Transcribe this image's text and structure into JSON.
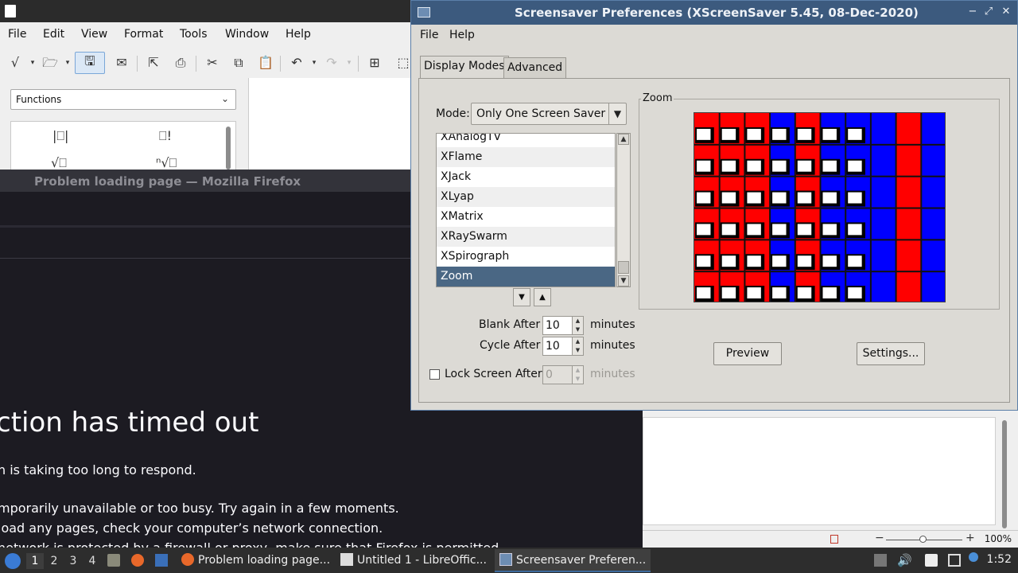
{
  "libreoffice": {
    "menus": [
      "File",
      "Edit",
      "View",
      "Format",
      "Tools",
      "Window",
      "Help"
    ],
    "elements_select": "Functions",
    "zoom": "100%",
    "zoom_minus": "−",
    "zoom_plus": "+"
  },
  "firefox": {
    "window_title": "Problem loading page — Mozilla Firefox",
    "heading": "ction has timed out",
    "subtext": "n is taking too long to respond.",
    "bullets": [
      "mporarily unavailable or too busy. Try again in a few moments.",
      "load any pages, check your computer’s network connection.",
      "network is protected by a firewall or proxy, make sure that Firefox is permitted"
    ]
  },
  "xscreensaver": {
    "title": "Screensaver Preferences  (XScreenSaver 5.45, 08-Dec-2020)",
    "menus": [
      "File",
      "Help"
    ],
    "tabs": [
      "Display Modes",
      "Advanced"
    ],
    "mode_label": "Mode:",
    "mode_value": "Only One Screen Saver",
    "list": [
      "XAnalogTV",
      "XFlame",
      "XJack",
      "XLyap",
      "XMatrix",
      "XRaySwarm",
      "XSpirograph",
      "Zoom"
    ],
    "selected": "Zoom",
    "blank_after_label": "Blank After",
    "blank_after_value": "10",
    "cycle_after_label": "Cycle After",
    "cycle_after_value": "10",
    "lock_label": "Lock Screen After",
    "lock_value": "0",
    "lock_checked": false,
    "minutes": "minutes",
    "preview_frame_label": "Zoom",
    "preview_button": "Preview",
    "settings_button": "Settings..."
  },
  "taskbar": {
    "workspaces": [
      "1",
      "2",
      "3",
      "4"
    ],
    "active_workspace": "1",
    "tasks": [
      "Problem loading page...",
      "Untitled 1 - LibreOffic...",
      "Screensaver Preferen..."
    ],
    "clock": "1:52"
  },
  "colors": {
    "titlebar_active": "#3c5a7e",
    "selection": "#4a6784",
    "dialog_bg": "#dcdad5",
    "firefox_bg": "#1c1b22",
    "preview_red": "#ff0000",
    "preview_blue": "#0000ff"
  }
}
